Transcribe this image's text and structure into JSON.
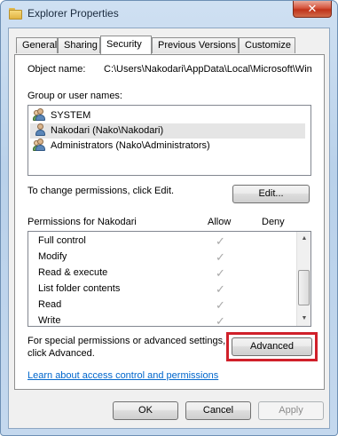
{
  "window": {
    "title": "Explorer Properties",
    "close_label": "✕"
  },
  "tabs": [
    {
      "label": "General"
    },
    {
      "label": "Sharing"
    },
    {
      "label": "Security"
    },
    {
      "label": "Previous Versions"
    },
    {
      "label": "Customize"
    }
  ],
  "active_tab": "Security",
  "object": {
    "label": "Object name:",
    "value": "C:\\Users\\Nakodari\\AppData\\Local\\Microsoft\\Win"
  },
  "groups": {
    "label": "Group or user names:",
    "items": [
      {
        "name": "SYSTEM",
        "icon": "group-users-icon"
      },
      {
        "name": "Nakodari (Nako\\Nakodari)",
        "icon": "user-icon",
        "selected": true
      },
      {
        "name": "Administrators (Nako\\Administrators)",
        "icon": "group-users-icon"
      }
    ]
  },
  "change_perms": {
    "text": "To change permissions, click Edit.",
    "edit_label": "Edit..."
  },
  "permissions": {
    "label": "Permissions for Nakodari",
    "allow_label": "Allow",
    "deny_label": "Deny",
    "rows": [
      {
        "name": "Full control",
        "allow": true,
        "deny": false
      },
      {
        "name": "Modify",
        "allow": true,
        "deny": false
      },
      {
        "name": "Read & execute",
        "allow": true,
        "deny": false
      },
      {
        "name": "List folder contents",
        "allow": true,
        "deny": false
      },
      {
        "name": "Read",
        "allow": true,
        "deny": false
      },
      {
        "name": "Write",
        "allow": true,
        "deny": false
      }
    ],
    "check_glyph": "✓"
  },
  "advanced": {
    "line1": "For special permissions or advanced settings,",
    "line2": "click Advanced.",
    "button_label": "Advanced",
    "highlight_color": "#d0202a"
  },
  "learn_link": "Learn about access control and permissions",
  "footer": {
    "ok": "OK",
    "cancel": "Cancel",
    "apply": "Apply"
  }
}
